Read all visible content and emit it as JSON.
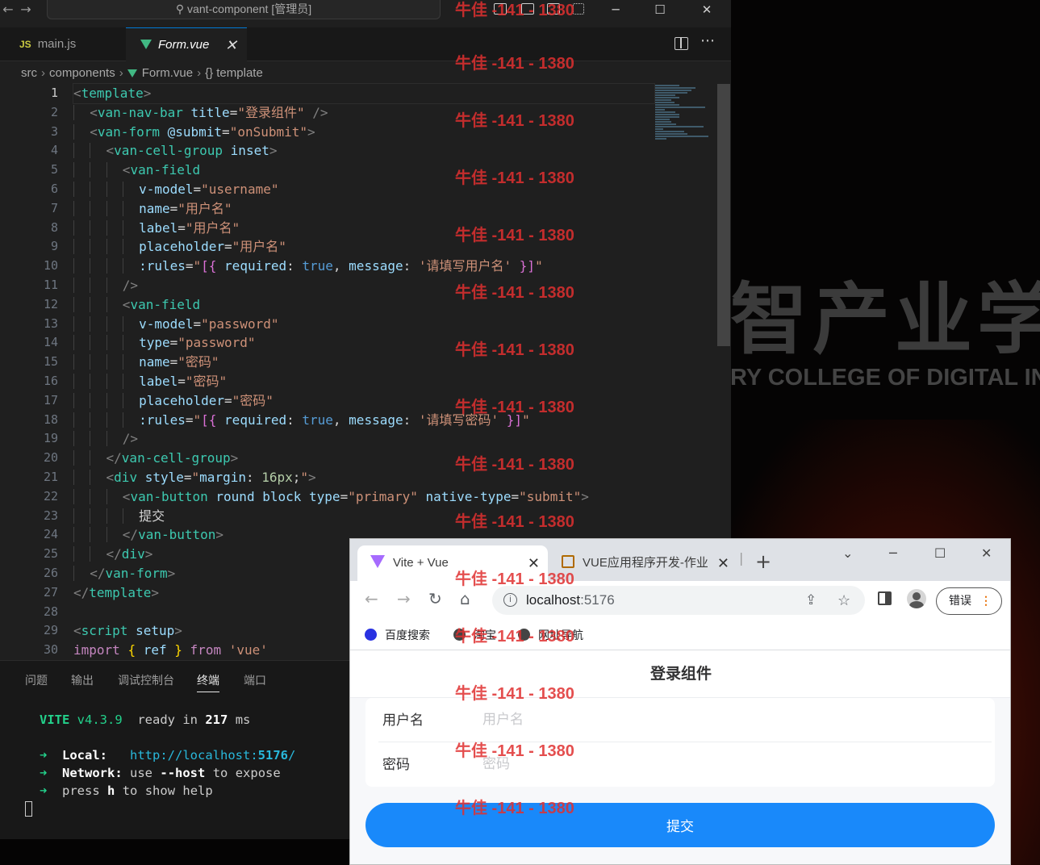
{
  "titlebar": {
    "back": "←",
    "forward": "→",
    "command_center": "vant-component [管理员]"
  },
  "tabs": [
    {
      "icon_text": "JS",
      "label": "main.js",
      "active": false
    },
    {
      "label": "Form.vue",
      "active": true,
      "close": "✕"
    }
  ],
  "breadcrumb": {
    "parts": [
      "src",
      "components",
      "Form.vue",
      "{} template"
    ],
    "sep": "›"
  },
  "editor": {
    "line_numbers": [
      "1",
      "2",
      "3",
      "4",
      "5",
      "6",
      "7",
      "8",
      "9",
      "10",
      "11",
      "12",
      "13",
      "14",
      "15",
      "16",
      "17",
      "18",
      "19",
      "20",
      "21",
      "22",
      "23",
      "24",
      "25",
      "26",
      "27",
      "28",
      "29",
      "30"
    ],
    "lines": [
      [
        [
          "tg",
          "<"
        ],
        [
          "tn",
          "template"
        ],
        [
          "tg",
          ">"
        ]
      ],
      [
        [
          "ind",
          "  "
        ],
        [
          "tg",
          "<"
        ],
        [
          "tn",
          "van-nav-bar"
        ],
        [
          "tx",
          " "
        ],
        [
          "an",
          "title"
        ],
        [
          "tx",
          "="
        ],
        [
          "sv",
          "\"登录组件\""
        ],
        [
          "tx",
          " "
        ],
        [
          "tg",
          "/>"
        ]
      ],
      [
        [
          "ind",
          "  "
        ],
        [
          "tg",
          "<"
        ],
        [
          "tn",
          "van-form"
        ],
        [
          "tx",
          " "
        ],
        [
          "an",
          "@submit"
        ],
        [
          "tx",
          "="
        ],
        [
          "sv",
          "\"onSubmit\""
        ],
        [
          "tg",
          ">"
        ]
      ],
      [
        [
          "ind",
          "  "
        ],
        [
          "ind",
          "  "
        ],
        [
          "tg",
          "<"
        ],
        [
          "tn",
          "van-cell-group"
        ],
        [
          "tx",
          " "
        ],
        [
          "an",
          "inset"
        ],
        [
          "tg",
          ">"
        ]
      ],
      [
        [
          "ind",
          "  "
        ],
        [
          "ind",
          "  "
        ],
        [
          "ind",
          "  "
        ],
        [
          "tg",
          "<"
        ],
        [
          "tn",
          "van-field"
        ]
      ],
      [
        [
          "ind",
          "  "
        ],
        [
          "ind",
          "  "
        ],
        [
          "ind",
          "  "
        ],
        [
          "ind",
          "  "
        ],
        [
          "an",
          "v-model"
        ],
        [
          "tx",
          "="
        ],
        [
          "sv",
          "\"username\""
        ]
      ],
      [
        [
          "ind",
          "  "
        ],
        [
          "ind",
          "  "
        ],
        [
          "ind",
          "  "
        ],
        [
          "ind",
          "  "
        ],
        [
          "an",
          "name"
        ],
        [
          "tx",
          "="
        ],
        [
          "sv",
          "\"用户名\""
        ]
      ],
      [
        [
          "ind",
          "  "
        ],
        [
          "ind",
          "  "
        ],
        [
          "ind",
          "  "
        ],
        [
          "ind",
          "  "
        ],
        [
          "an",
          "label"
        ],
        [
          "tx",
          "="
        ],
        [
          "sv",
          "\"用户名\""
        ]
      ],
      [
        [
          "ind",
          "  "
        ],
        [
          "ind",
          "  "
        ],
        [
          "ind",
          "  "
        ],
        [
          "ind",
          "  "
        ],
        [
          "an",
          "placeholder"
        ],
        [
          "tx",
          "="
        ],
        [
          "sv",
          "\"用户名\""
        ]
      ],
      [
        [
          "ind",
          "  "
        ],
        [
          "ind",
          "  "
        ],
        [
          "ind",
          "  "
        ],
        [
          "ind",
          "  "
        ],
        [
          "an",
          ":rules"
        ],
        [
          "tx",
          "="
        ],
        [
          "sv",
          "\""
        ],
        [
          "pk",
          "[{"
        ],
        [
          "tx",
          " "
        ],
        [
          "an",
          "required"
        ],
        [
          "tx",
          ": "
        ],
        [
          "bl",
          "true"
        ],
        [
          "tx",
          ", "
        ],
        [
          "an",
          "message"
        ],
        [
          "tx",
          ": "
        ],
        [
          "sv",
          "'请填写用户名'"
        ],
        [
          "tx",
          " "
        ],
        [
          "pk",
          "}]"
        ],
        [
          "sv",
          "\""
        ]
      ],
      [
        [
          "ind",
          "  "
        ],
        [
          "ind",
          "  "
        ],
        [
          "ind",
          "  "
        ],
        [
          "tg",
          "/>"
        ]
      ],
      [
        [
          "ind",
          "  "
        ],
        [
          "ind",
          "  "
        ],
        [
          "ind",
          "  "
        ],
        [
          "tg",
          "<"
        ],
        [
          "tn",
          "van-field"
        ]
      ],
      [
        [
          "ind",
          "  "
        ],
        [
          "ind",
          "  "
        ],
        [
          "ind",
          "  "
        ],
        [
          "ind",
          "  "
        ],
        [
          "an",
          "v-model"
        ],
        [
          "tx",
          "="
        ],
        [
          "sv",
          "\"password\""
        ]
      ],
      [
        [
          "ind",
          "  "
        ],
        [
          "ind",
          "  "
        ],
        [
          "ind",
          "  "
        ],
        [
          "ind",
          "  "
        ],
        [
          "an",
          "type"
        ],
        [
          "tx",
          "="
        ],
        [
          "sv",
          "\"password\""
        ]
      ],
      [
        [
          "ind",
          "  "
        ],
        [
          "ind",
          "  "
        ],
        [
          "ind",
          "  "
        ],
        [
          "ind",
          "  "
        ],
        [
          "an",
          "name"
        ],
        [
          "tx",
          "="
        ],
        [
          "sv",
          "\"密码\""
        ]
      ],
      [
        [
          "ind",
          "  "
        ],
        [
          "ind",
          "  "
        ],
        [
          "ind",
          "  "
        ],
        [
          "ind",
          "  "
        ],
        [
          "an",
          "label"
        ],
        [
          "tx",
          "="
        ],
        [
          "sv",
          "\"密码\""
        ]
      ],
      [
        [
          "ind",
          "  "
        ],
        [
          "ind",
          "  "
        ],
        [
          "ind",
          "  "
        ],
        [
          "ind",
          "  "
        ],
        [
          "an",
          "placeholder"
        ],
        [
          "tx",
          "="
        ],
        [
          "sv",
          "\"密码\""
        ]
      ],
      [
        [
          "ind",
          "  "
        ],
        [
          "ind",
          "  "
        ],
        [
          "ind",
          "  "
        ],
        [
          "ind",
          "  "
        ],
        [
          "an",
          ":rules"
        ],
        [
          "tx",
          "="
        ],
        [
          "sv",
          "\""
        ],
        [
          "pk",
          "[{"
        ],
        [
          "tx",
          " "
        ],
        [
          "an",
          "required"
        ],
        [
          "tx",
          ": "
        ],
        [
          "bl",
          "true"
        ],
        [
          "tx",
          ", "
        ],
        [
          "an",
          "message"
        ],
        [
          "tx",
          ": "
        ],
        [
          "sv",
          "'请填写密码'"
        ],
        [
          "tx",
          " "
        ],
        [
          "pk",
          "}]"
        ],
        [
          "sv",
          "\""
        ]
      ],
      [
        [
          "ind",
          "  "
        ],
        [
          "ind",
          "  "
        ],
        [
          "ind",
          "  "
        ],
        [
          "tg",
          "/>"
        ]
      ],
      [
        [
          "ind",
          "  "
        ],
        [
          "ind",
          "  "
        ],
        [
          "tg",
          "</"
        ],
        [
          "tn",
          "van-cell-group"
        ],
        [
          "tg",
          ">"
        ]
      ],
      [
        [
          "ind",
          "  "
        ],
        [
          "ind",
          "  "
        ],
        [
          "tg",
          "<"
        ],
        [
          "tn",
          "div"
        ],
        [
          "tx",
          " "
        ],
        [
          "an",
          "style"
        ],
        [
          "tx",
          "="
        ],
        [
          "sv",
          "\""
        ],
        [
          "an",
          "margin"
        ],
        [
          "tx",
          ": "
        ],
        [
          "nm",
          "16px"
        ],
        [
          "tx",
          ";"
        ],
        [
          "sv",
          "\""
        ],
        [
          "tg",
          ">"
        ]
      ],
      [
        [
          "ind",
          "  "
        ],
        [
          "ind",
          "  "
        ],
        [
          "ind",
          "  "
        ],
        [
          "tg",
          "<"
        ],
        [
          "tn",
          "van-button"
        ],
        [
          "tx",
          " "
        ],
        [
          "an",
          "round"
        ],
        [
          "tx",
          " "
        ],
        [
          "an",
          "block"
        ],
        [
          "tx",
          " "
        ],
        [
          "an",
          "type"
        ],
        [
          "tx",
          "="
        ],
        [
          "sv",
          "\"primary\""
        ],
        [
          "tx",
          " "
        ],
        [
          "an",
          "native-type"
        ],
        [
          "tx",
          "="
        ],
        [
          "sv",
          "\"submit\""
        ],
        [
          "tg",
          ">"
        ]
      ],
      [
        [
          "ind",
          "  "
        ],
        [
          "ind",
          "  "
        ],
        [
          "ind",
          "  "
        ],
        [
          "ind",
          "  "
        ],
        [
          "tx",
          "提交"
        ]
      ],
      [
        [
          "ind",
          "  "
        ],
        [
          "ind",
          "  "
        ],
        [
          "ind",
          "  "
        ],
        [
          "tg",
          "</"
        ],
        [
          "tn",
          "van-button"
        ],
        [
          "tg",
          ">"
        ]
      ],
      [
        [
          "ind",
          "  "
        ],
        [
          "ind",
          "  "
        ],
        [
          "tg",
          "</"
        ],
        [
          "tn",
          "div"
        ],
        [
          "tg",
          ">"
        ]
      ],
      [
        [
          "ind",
          "  "
        ],
        [
          "tg",
          "</"
        ],
        [
          "tn",
          "van-form"
        ],
        [
          "tg",
          ">"
        ]
      ],
      [
        [
          "tg",
          "</"
        ],
        [
          "tn",
          "template"
        ],
        [
          "tg",
          ">"
        ]
      ],
      [
        [
          "tx",
          " "
        ]
      ],
      [
        [
          "tg",
          "<"
        ],
        [
          "tn",
          "script"
        ],
        [
          "tx",
          " "
        ],
        [
          "an",
          "setup"
        ],
        [
          "tg",
          ">"
        ]
      ],
      [
        [
          "kw",
          "import"
        ],
        [
          "tx",
          " "
        ],
        [
          "br",
          "{"
        ],
        [
          "tx",
          " "
        ],
        [
          "an",
          "ref"
        ],
        [
          "tx",
          " "
        ],
        [
          "br",
          "}"
        ],
        [
          "tx",
          " "
        ],
        [
          "kw",
          "from"
        ],
        [
          "tx",
          " "
        ],
        [
          "sv",
          "'vue'"
        ]
      ]
    ]
  },
  "panel": {
    "tabs": [
      "问题",
      "输出",
      "调试控制台",
      "终端",
      "端口"
    ],
    "active_tab": "终端",
    "terminal": {
      "vite_name": "VITE",
      "vite_version": "v4.3.9",
      "ready_text": "ready in",
      "ready_ms": "217",
      "ready_unit": "ms",
      "arrow": "➜",
      "local_label": "Local:",
      "local_url_base": "http://localhost:",
      "local_url_port": "5176",
      "local_url_tail": "/",
      "network_label": "Network:",
      "network_text_1": "use",
      "network_flag": "--host",
      "network_text_2": "to expose",
      "help_text_1": "press",
      "help_key": "h",
      "help_text_2": "to show help"
    }
  },
  "browser": {
    "tabs": [
      {
        "title": "Vite + Vue",
        "active": true
      },
      {
        "title": "VUE应用程序开发-作业",
        "active": false
      }
    ],
    "new_tab": "+",
    "url_host": "localhost",
    "url_port": ":5176",
    "error_label": "错误",
    "bookmarks": [
      "百度搜索",
      "淘宝",
      "网址导航"
    ],
    "page": {
      "nav_title": "登录组件",
      "fields": [
        {
          "label": "用户名",
          "placeholder": "用户名"
        },
        {
          "label": "密码",
          "placeholder": "密码"
        }
      ],
      "submit_label": "提交"
    }
  },
  "desktop": {
    "banner_cn": "智产业学",
    "banner_en": "RY COLLEGE OF  DIGITAL INT"
  },
  "watermark": "牛佳 -141 - 1380"
}
